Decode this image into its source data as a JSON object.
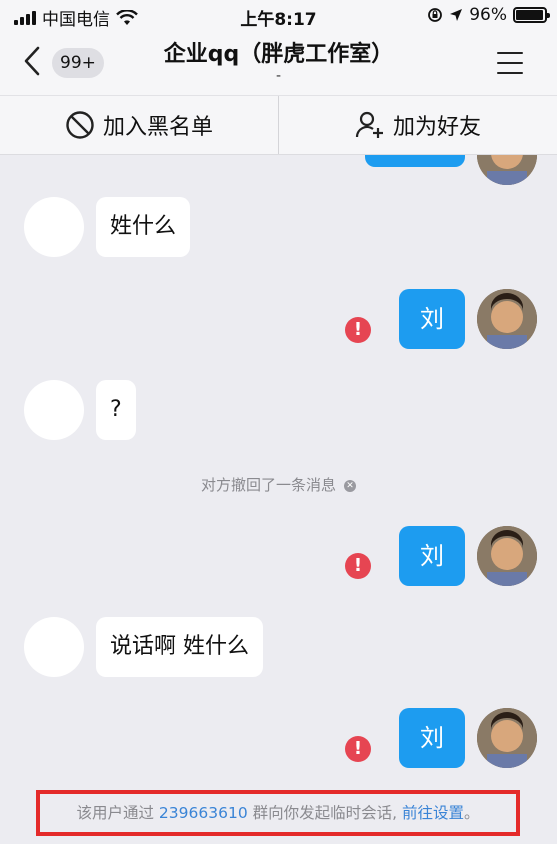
{
  "status_bar": {
    "carrier": "中国电信",
    "time": "上午8:17",
    "battery_percent": "96%",
    "battery_level": 0.96
  },
  "nav": {
    "unread_badge": "99+",
    "title": "企业qq（胖虎工作室）",
    "subtitle": "-"
  },
  "actions": {
    "blacklist_label": "加入黑名单",
    "add_friend_label": "加为好友"
  },
  "messages": {
    "m1": "姓什么",
    "m2": "刘",
    "m3": "?",
    "recall_notice": "对方撤回了一条消息",
    "m4": "刘",
    "m5": "说话啊 姓什么",
    "m6": "刘"
  },
  "notice": {
    "prefix": "该用户通过",
    "group_number": "239663610",
    "middle": "群向你发起临时会话,",
    "link": "前往设置",
    "suffix": "。"
  },
  "colors": {
    "accent_blue": "#1d9cf0",
    "error_red": "#e64552",
    "link_blue": "#3a84d6",
    "highlight_border": "#e42a2a"
  }
}
